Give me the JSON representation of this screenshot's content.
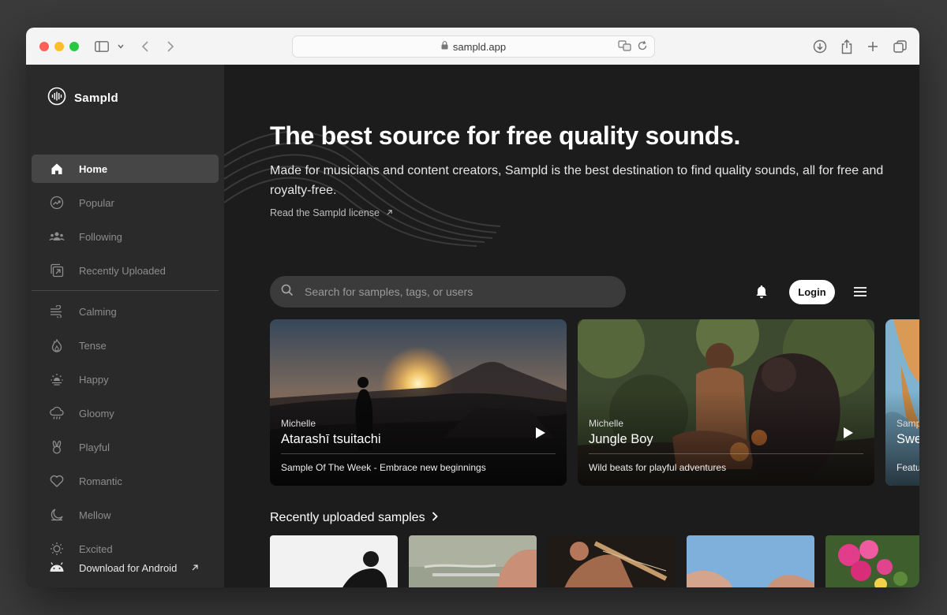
{
  "browser": {
    "address": "sampld.app"
  },
  "sidebar": {
    "brand": "Sampld",
    "primary": [
      {
        "label": "Home",
        "icon": "home-icon",
        "active": true
      },
      {
        "label": "Popular",
        "icon": "trending-icon"
      },
      {
        "label": "Following",
        "icon": "people-icon"
      },
      {
        "label": "Recently Uploaded",
        "icon": "upload-icon"
      }
    ],
    "moods": [
      {
        "label": "Calming",
        "icon": "wind-icon"
      },
      {
        "label": "Tense",
        "icon": "flame-icon"
      },
      {
        "label": "Happy",
        "icon": "sun-bright-icon"
      },
      {
        "label": "Gloomy",
        "icon": "cloud-rain-icon"
      },
      {
        "label": "Playful",
        "icon": "bunny-icon"
      },
      {
        "label": "Romantic",
        "icon": "heart-icon"
      },
      {
        "label": "Mellow",
        "icon": "moon-icon"
      },
      {
        "label": "Excited",
        "icon": "sun-icon"
      }
    ],
    "android": "Download for Android"
  },
  "hero": {
    "title": "The best source for free quality sounds.",
    "subtitle": "Made for musicians and content creators, Sampld is the best destination to find quality sounds, all for free and royalty-free.",
    "license_link": "Read the Sampld license"
  },
  "search": {
    "placeholder": "Search for samples, tags, or users"
  },
  "header": {
    "login": "Login"
  },
  "featured": [
    {
      "author": "Michelle",
      "title": "Atarashī tsuitachi",
      "desc": "Sample Of The Week - Embrace new beginnings"
    },
    {
      "author": "Michelle",
      "title": "Jungle Boy",
      "desc": "Wild beats for playful adventures"
    },
    {
      "author": "Samp",
      "title": "Swe",
      "desc": "Featu"
    }
  ],
  "recent": {
    "title": "Recently uploaded samples"
  },
  "colors": {
    "sidebar_bg": "#2a2a2a",
    "main_bg": "#1c1c1c",
    "active_item": "#464646",
    "accent": "#ffffff"
  }
}
